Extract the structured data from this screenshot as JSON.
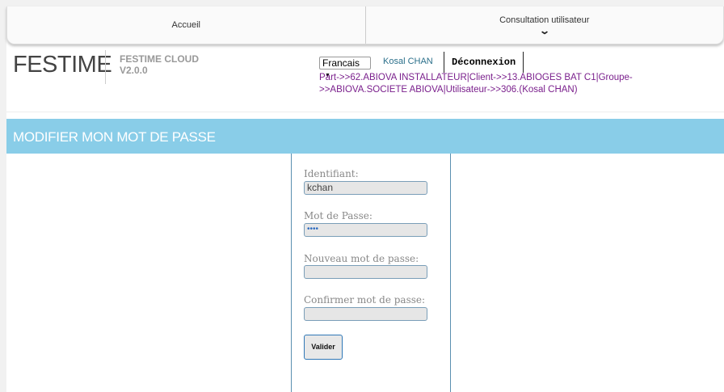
{
  "nav": {
    "items": [
      {
        "label": "Accueil"
      },
      {
        "label": "Consultation utilisateur"
      }
    ]
  },
  "header": {
    "brand": "FESTIME",
    "product": "FESTIME CLOUD",
    "version": "V2.0.0",
    "language": "Francais",
    "user": "Kosal CHAN",
    "logout": "Déconnexion",
    "context": "Part->>62.ABIOVA INSTALLATEUR|Client->>13.ABIOGES BAT C1|Groupe->>ABIOVA.SOCIETE ABIOVA|Utilisateur->>306.(Kosal CHAN)"
  },
  "page": {
    "title": "MODIFIER MON MOT DE PASSE",
    "band_color": "#89cde8"
  },
  "form": {
    "identifiant_label": "Identifiant:",
    "identifiant_value": "kchan",
    "password_label": "Mot de Passe:",
    "password_value": "••••",
    "new_password_label": "Nouveau mot de passe:",
    "new_password_value": "",
    "confirm_password_label": "Confirmer mot de passe:",
    "confirm_password_value": "",
    "submit_label": "Valider"
  }
}
